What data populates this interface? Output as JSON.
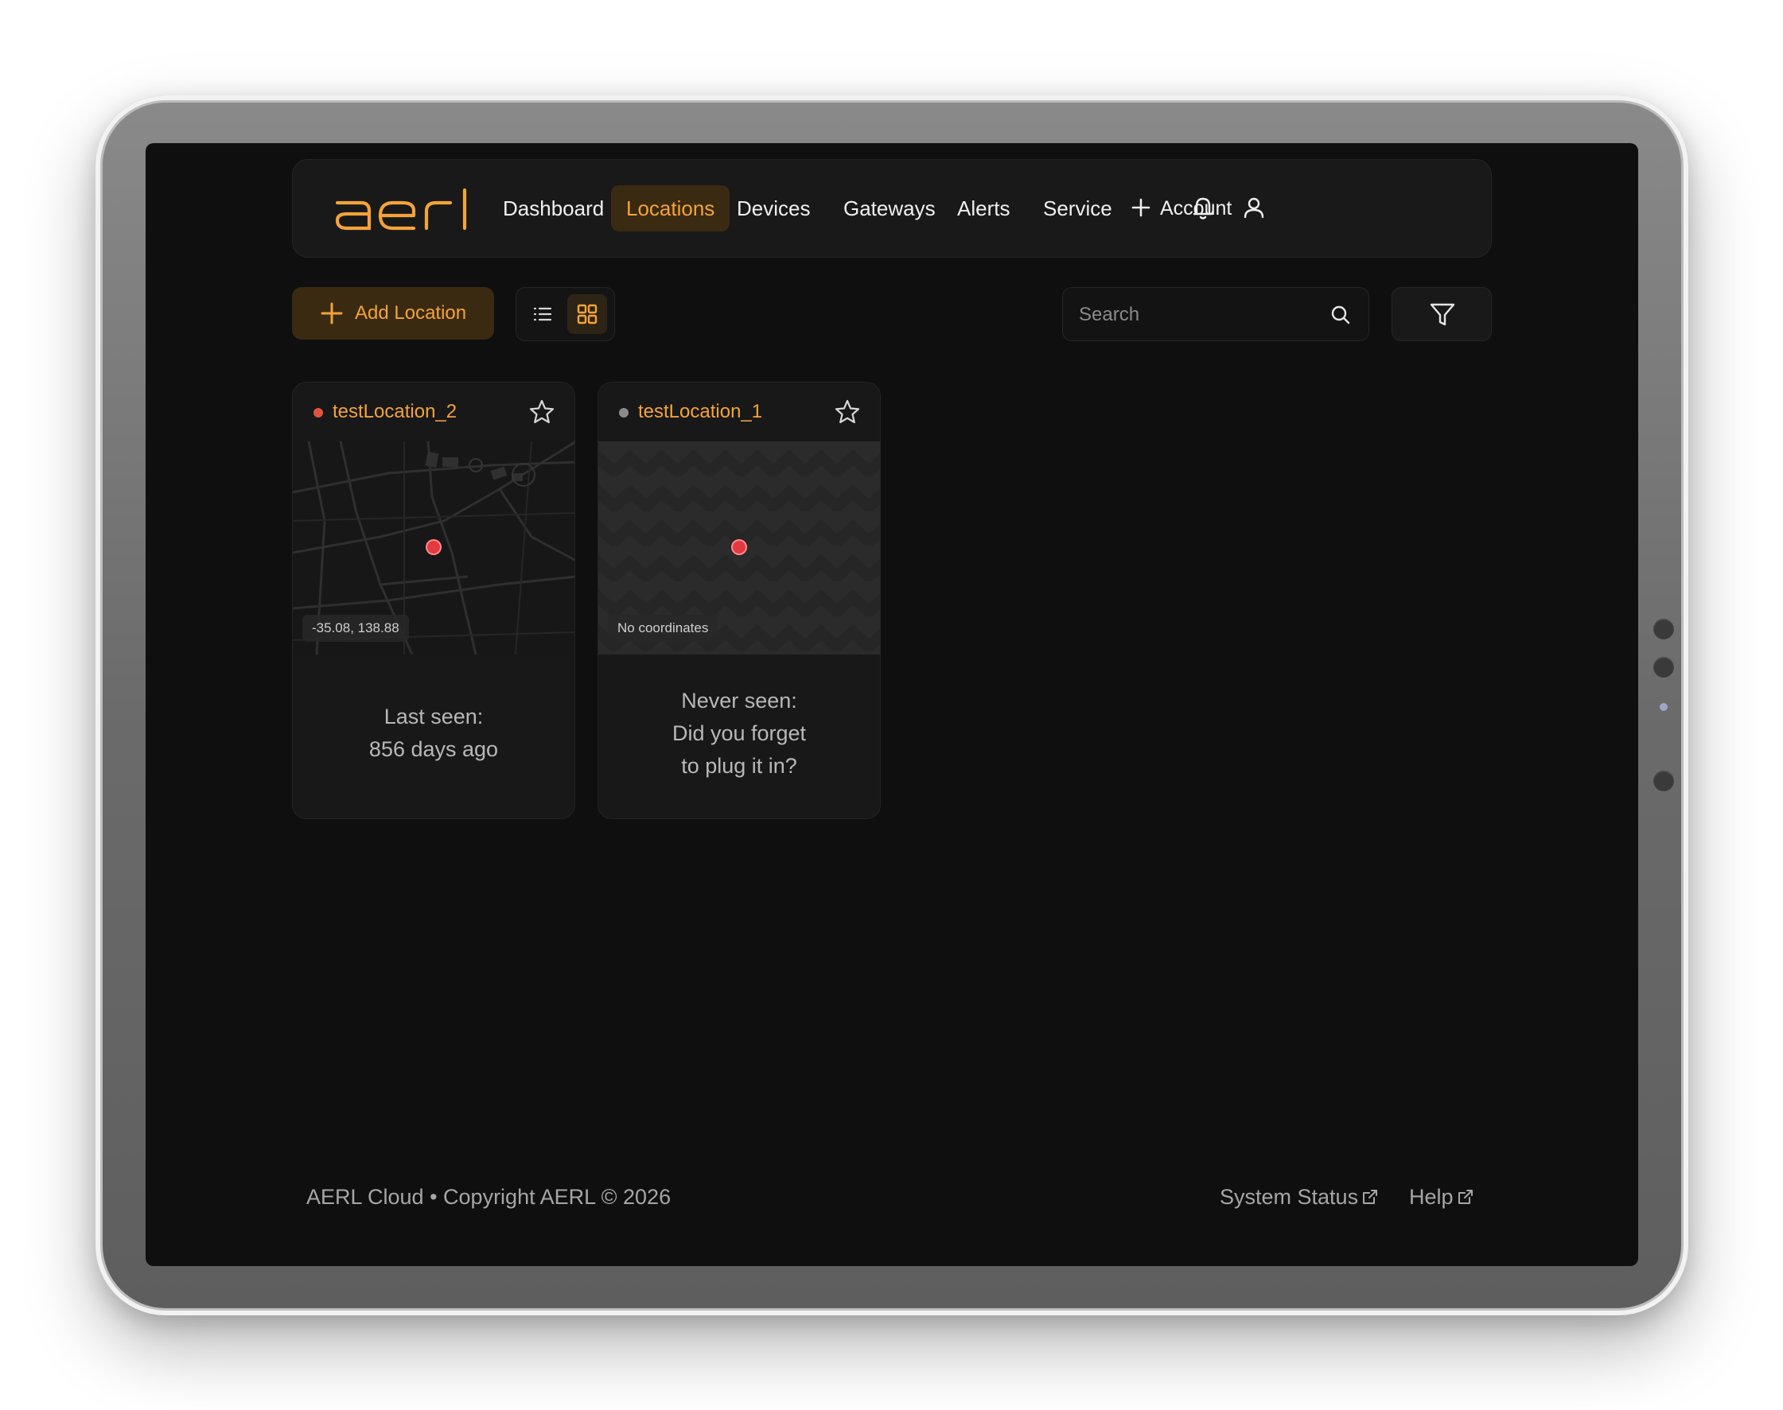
{
  "brand": {
    "logo_text": "aerl",
    "accent_color": "#f3a33b"
  },
  "nav": {
    "items": [
      {
        "label": "Dashboard",
        "active": false
      },
      {
        "label": "Locations",
        "active": true
      },
      {
        "label": "Devices",
        "active": false
      },
      {
        "label": "Gateways",
        "active": false
      },
      {
        "label": "Alerts",
        "active": false
      },
      {
        "label": "Service",
        "active": false
      }
    ],
    "add_icon": "plus-icon",
    "notifications_icon": "bell-icon",
    "account_label": "Account",
    "account_icon": "user-icon"
  },
  "toolbar": {
    "add_location_label": "Add Location",
    "view_modes": [
      {
        "name": "list",
        "icon": "list-icon",
        "active": false
      },
      {
        "name": "grid",
        "icon": "grid-icon",
        "active": true
      }
    ],
    "search_placeholder": "Search",
    "search_icon": "search-icon",
    "filter_icon": "filter-icon"
  },
  "locations": [
    {
      "name": "testLocation_2",
      "status_color": "#e2553c",
      "map_type": "street-map",
      "map_label": "-35.08, 138.88",
      "status_line_1": "Last seen:",
      "status_line_2": "856 days ago",
      "status_line_3": ""
    },
    {
      "name": "testLocation_1",
      "status_color": "#8a8a8a",
      "map_type": "placeholder-pattern",
      "map_label": "No coordinates",
      "status_line_1": "Never seen:",
      "status_line_2": "Did you forget",
      "status_line_3": "to plug it in?"
    }
  ],
  "footer": {
    "copyright": "AERL Cloud • Copyright AERL © 2026",
    "links": [
      {
        "label": "System Status",
        "icon": "external-link-icon"
      },
      {
        "label": "Help",
        "icon": "external-link-icon"
      }
    ]
  }
}
